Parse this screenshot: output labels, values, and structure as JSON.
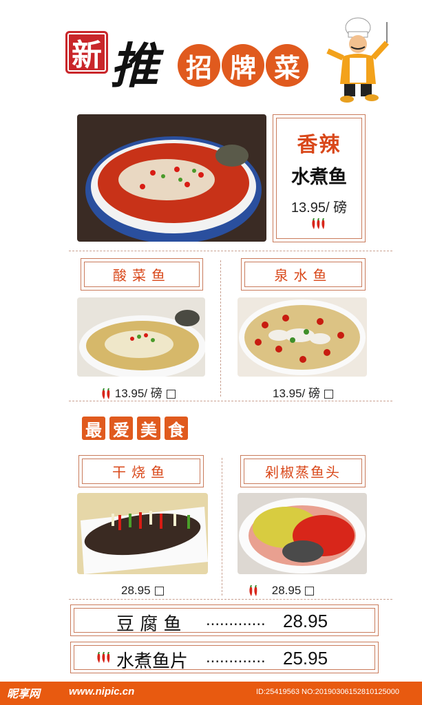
{
  "header": {
    "seal_char": "新",
    "tui_char": "推",
    "title_chars": [
      "招",
      "牌",
      "菜"
    ]
  },
  "featured": {
    "name_line1": "香辣",
    "name_line2": "水煮鱼",
    "price": "13.95/ 磅"
  },
  "row1": [
    {
      "name": "酸菜鱼",
      "price": "13.95/ 磅",
      "spicy": true
    },
    {
      "name": "泉水鱼",
      "price": "13.95/ 磅",
      "spicy": false
    }
  ],
  "section2": {
    "chars": [
      "最",
      "爱",
      "美",
      "食"
    ]
  },
  "row2": [
    {
      "name": "干烧鱼",
      "price": "28.95",
      "spicy": false
    },
    {
      "name": "剁椒蒸鱼头",
      "price": "28.95",
      "spicy": true
    }
  ],
  "list": [
    {
      "name": "豆 腐 鱼",
      "dots": ".............",
      "price": "28.95",
      "spicy": false
    },
    {
      "name": "水煮鱼片",
      "dots": ".............",
      "price": "25.95",
      "spicy": true
    }
  ],
  "watermark": {
    "logo": "昵享网",
    "url": "www.nipic.cn",
    "id": "ID:25419563 NO:20190306152810125000"
  },
  "colors": {
    "accent": "#e05a1e",
    "frame": "#c97a5a",
    "bar": "#e85a10"
  }
}
